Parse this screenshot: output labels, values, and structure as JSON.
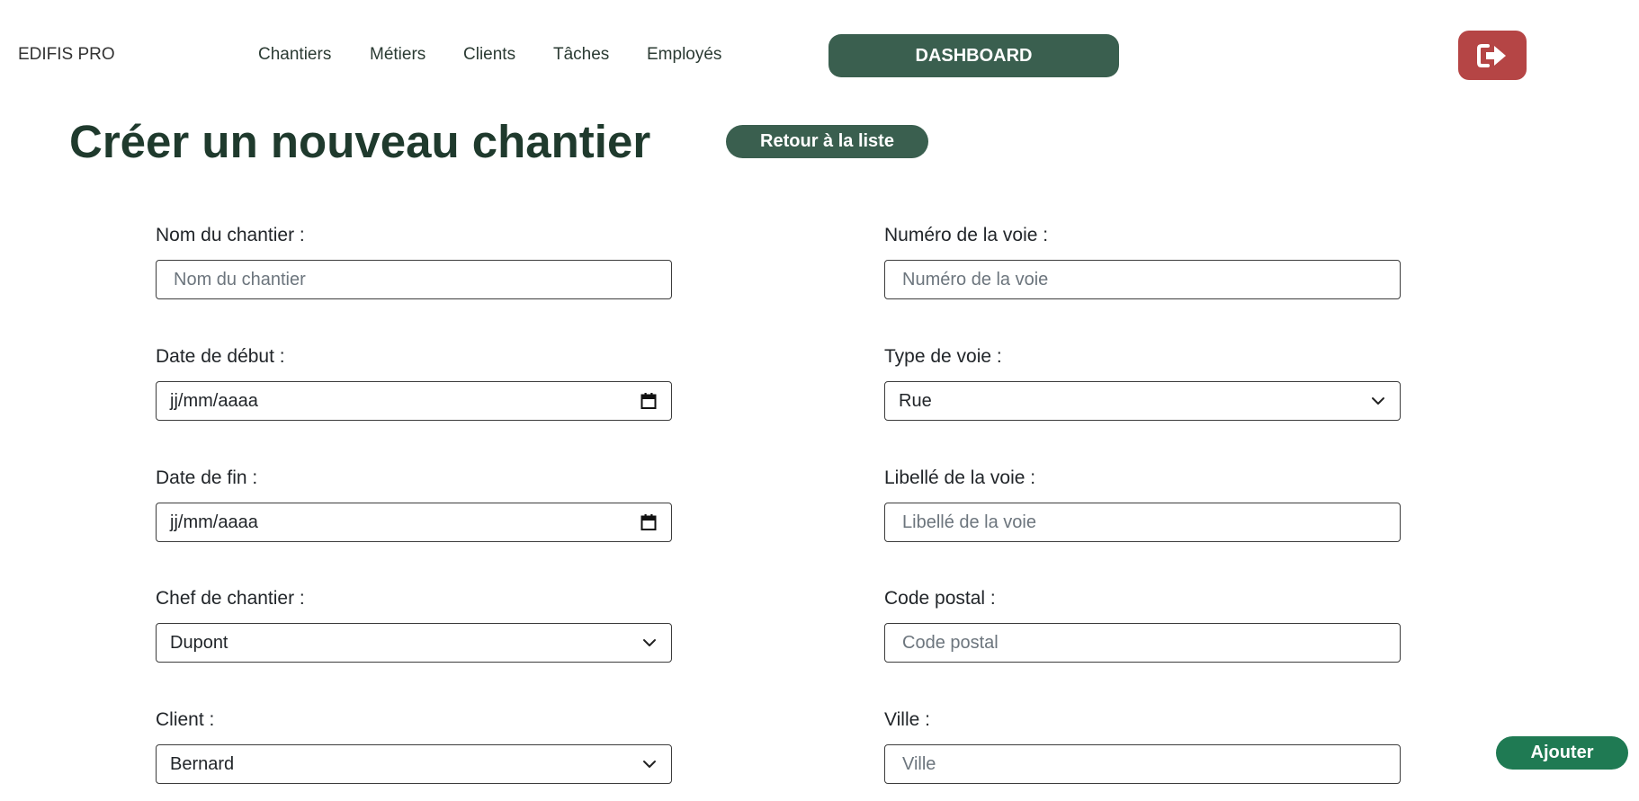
{
  "header": {
    "brand": "EDIFIS PRO",
    "nav": [
      "Chantiers",
      "Métiers",
      "Clients",
      "Tâches",
      "Employés"
    ],
    "dashboard_label": "DASHBOARD",
    "logout_icon": "logout-icon"
  },
  "main": {
    "title": "Créer un nouveau chantier",
    "back_label": "Retour à la liste",
    "submit_label": "Ajouter"
  },
  "form": {
    "nom": {
      "label": "Nom du chantier :",
      "placeholder": "Nom du chantier"
    },
    "date_debut": {
      "label": "Date de début :",
      "value": "jj/mm/aaaa"
    },
    "date_fin": {
      "label": "Date de fin :",
      "value": "jj/mm/aaaa"
    },
    "chef": {
      "label": "Chef de chantier :",
      "value": "Dupont"
    },
    "client": {
      "label": "Client :",
      "value": "Bernard"
    },
    "numero": {
      "label": "Numéro de la voie :",
      "placeholder": "Numéro de la voie"
    },
    "type_voie": {
      "label": "Type de voie :",
      "value": "Rue"
    },
    "libelle": {
      "label": "Libellé de la voie :",
      "placeholder": "Libellé de la voie"
    },
    "code_postal": {
      "label": "Code postal :",
      "placeholder": "Code postal"
    },
    "ville": {
      "label": "Ville :",
      "placeholder": "Ville"
    }
  },
  "colors": {
    "primary": "#3a5f4f",
    "danger": "#b54545",
    "success": "#1f7a53",
    "title": "#1f3a2d"
  }
}
